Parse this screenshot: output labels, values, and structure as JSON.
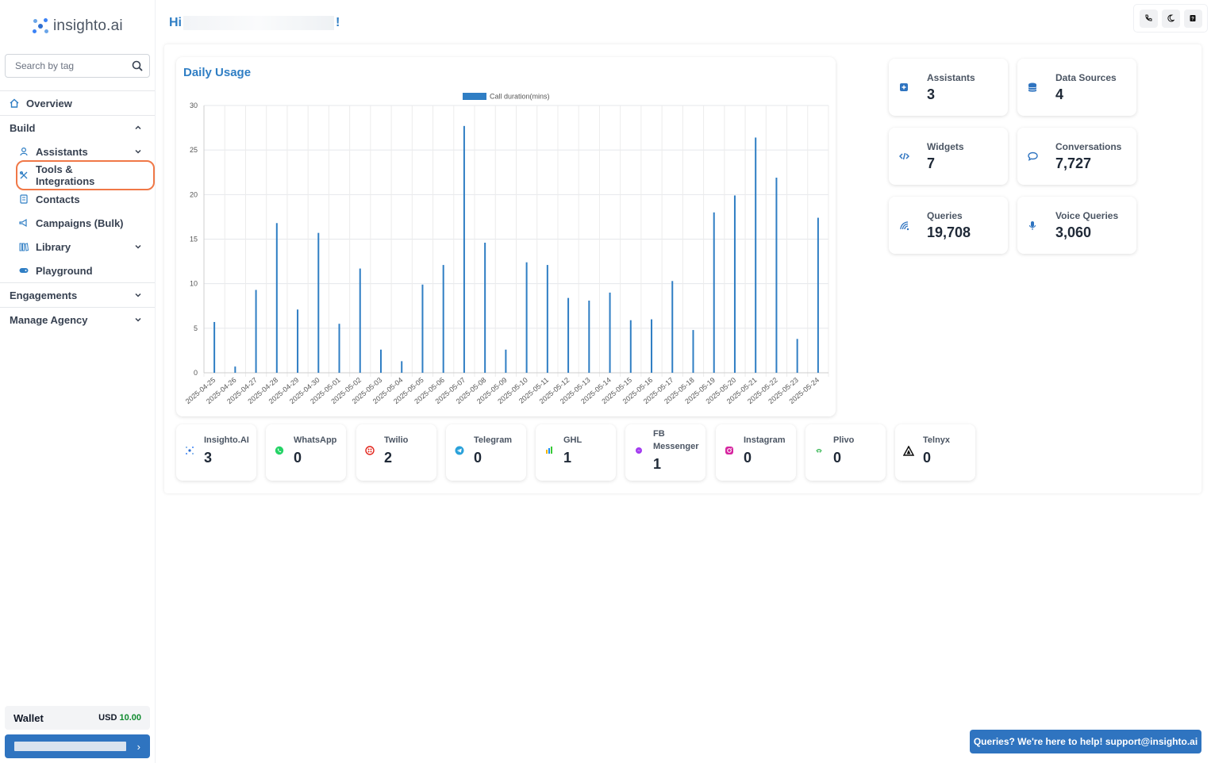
{
  "brand": {
    "name": "insighto.ai"
  },
  "search": {
    "placeholder": "Search by tag"
  },
  "nav": {
    "overview": "Overview",
    "build": "Build",
    "assistants": "Assistants",
    "tools": "Tools & Integrations",
    "contacts": "Contacts",
    "campaigns": "Campaigns (Bulk)",
    "library": "Library",
    "playground": "Playground",
    "engagements": "Engagements",
    "agency": "Manage Agency"
  },
  "wallet": {
    "label": "Wallet",
    "currency": "USD",
    "amount": "10.00"
  },
  "header": {
    "greeting_prefix": "Hi",
    "greeting_suffix": "!"
  },
  "top_icons": [
    "phone-icon",
    "moon-icon",
    "help-book-icon"
  ],
  "chart_data": {
    "type": "bar",
    "title": "Daily Usage",
    "ylim": [
      0,
      30
    ],
    "yticks": [
      0,
      5,
      10,
      15,
      20,
      25,
      30
    ],
    "grid": true,
    "legend": "top-center",
    "series": [
      {
        "name": "Call duration(mins)",
        "color": "#2f7ec4",
        "values": [
          5.7,
          0.7,
          9.3,
          16.8,
          7.1,
          15.7,
          5.5,
          11.7,
          2.6,
          1.3,
          9.9,
          12.1,
          27.7,
          14.6,
          2.6,
          12.4,
          12.1,
          8.4,
          8.1,
          9.0,
          5.9,
          6.0,
          10.3,
          4.8,
          18.0,
          19.9,
          26.4,
          21.9,
          3.8,
          17.4
        ]
      }
    ],
    "categories": [
      "2025-04-25",
      "2025-04-26",
      "2025-04-27",
      "2025-04-28",
      "2025-04-29",
      "2025-04-30",
      "2025-05-01",
      "2025-05-02",
      "2025-05-03",
      "2025-05-04",
      "2025-05-05",
      "2025-05-06",
      "2025-05-07",
      "2025-05-08",
      "2025-05-09",
      "2025-05-10",
      "2025-05-11",
      "2025-05-12",
      "2025-05-13",
      "2025-05-14",
      "2025-05-15",
      "2025-05-16",
      "2025-05-17",
      "2025-05-18",
      "2025-05-19",
      "2025-05-20",
      "2025-05-21",
      "2025-05-22",
      "2025-05-23",
      "2025-05-24"
    ]
  },
  "stats": {
    "assistants": {
      "label": "Assistants",
      "value": "3"
    },
    "data_sources": {
      "label": "Data Sources",
      "value": "4"
    },
    "widgets": {
      "label": "Widgets",
      "value": "7"
    },
    "conversations": {
      "label": "Conversations",
      "value": "7,727"
    },
    "queries": {
      "label": "Queries",
      "value": "19,708"
    },
    "voice_queries": {
      "label": "Voice Queries",
      "value": "3,060"
    }
  },
  "channels": [
    {
      "label": "Insighto.AI",
      "value": "3"
    },
    {
      "label": "WhatsApp",
      "value": "0"
    },
    {
      "label": "Twilio",
      "value": "2"
    },
    {
      "label": "Telegram",
      "value": "0"
    },
    {
      "label": "GHL",
      "value": "1"
    },
    {
      "label": "FB Messenger",
      "value": "1"
    },
    {
      "label": "Instagram",
      "value": "0"
    },
    {
      "label": "Plivo",
      "value": "0"
    },
    {
      "label": "Telnyx",
      "value": "0"
    }
  ],
  "help": {
    "text": "Queries? We're here to help! support@insighto.ai"
  }
}
